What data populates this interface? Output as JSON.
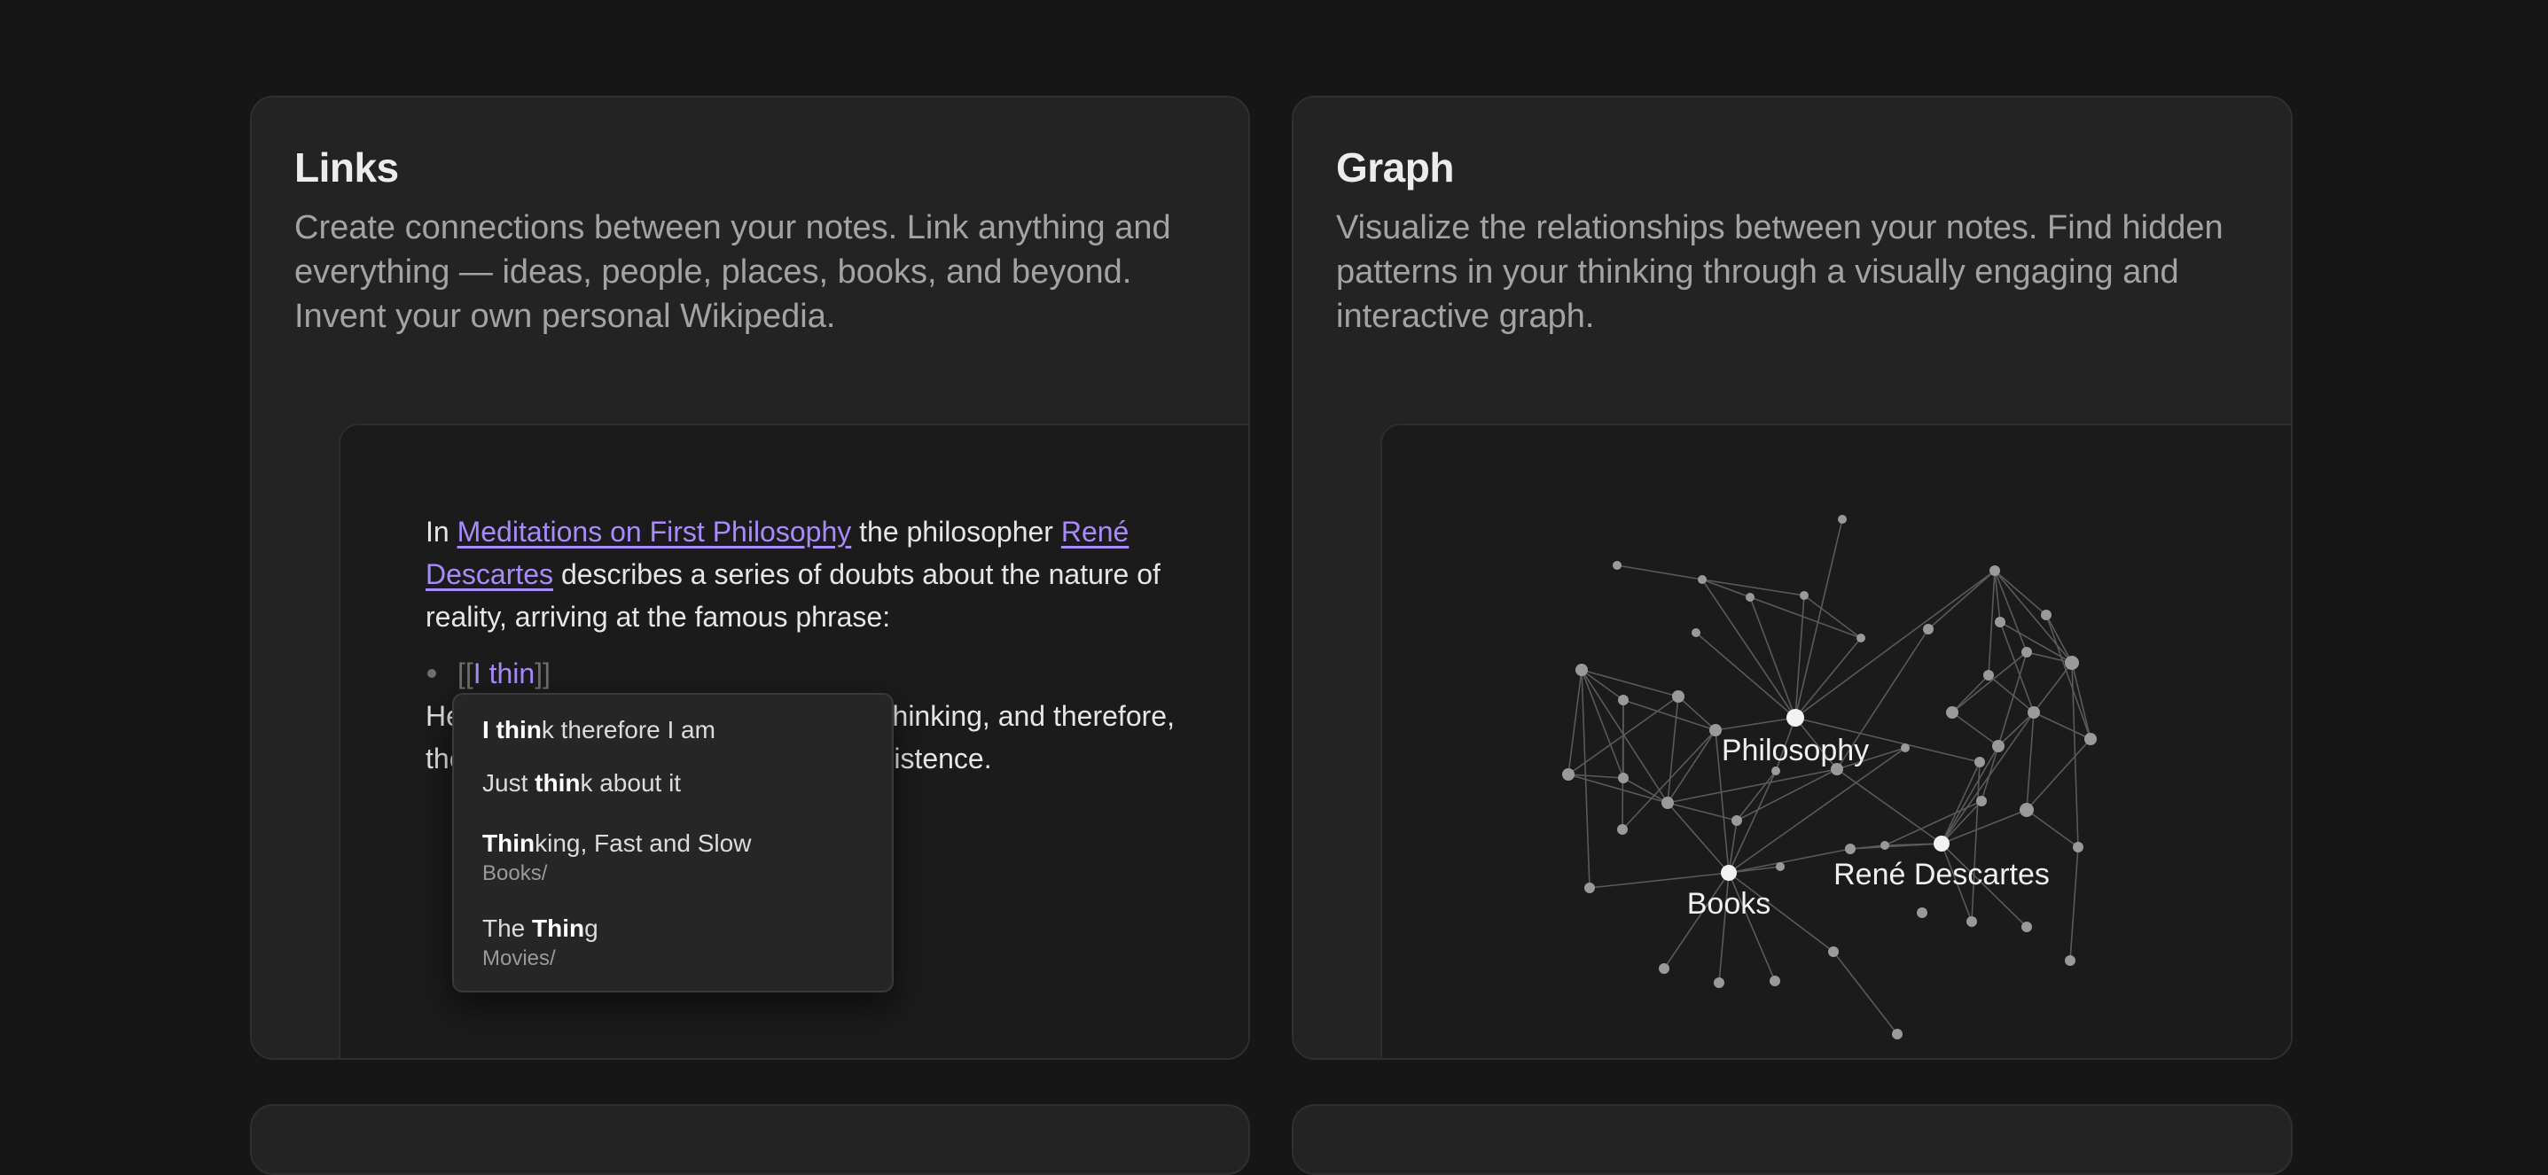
{
  "links_card": {
    "title": "Links",
    "description": "Create connections between your notes. Link anything and everything — ideas, people, places, books, and beyond. Invent your own personal Wikipedia.",
    "editor": {
      "p1_in": "In ",
      "link_meditations": "Meditations on First Philosophy",
      "p1_mid": " the philosopher ",
      "link_descartes": "René Descartes",
      "p1_end": " describes a series of doubts about the nature of reality, arriving at the famous phrase:",
      "bracket_open": "[[",
      "typed": "I thin",
      "bracket_close": "]]",
      "p2": "He argues that doubting is a form of thinking, and therefore, the act of doubting proves his own existence."
    },
    "suggestions": [
      {
        "bold": "I thin",
        "rest": "k therefore I am",
        "prefix": "",
        "path": ""
      },
      {
        "prefix": "Just ",
        "bold": "thin",
        "rest": "k about it",
        "path": ""
      },
      {
        "prefix": "",
        "bold": "Thin",
        "rest": "king, Fast and Slow",
        "path": "Books/"
      },
      {
        "prefix": "The ",
        "bold": "Thin",
        "rest": "g",
        "path": "Movies/"
      }
    ]
  },
  "graph_card": {
    "title": "Graph",
    "description": "Visualize the relationships between your notes. Find hidden patterns in your thinking through a visually engaging and interactive graph.",
    "labels": {
      "philosophy": "Philosophy",
      "descartes": "René Descartes",
      "books": "Books"
    }
  },
  "colors": {
    "background": "#161616",
    "card": "#232323",
    "link_accent": "#a88bfa",
    "graph_node": "#9a9a9a",
    "graph_edge": "#5a5a5a"
  }
}
